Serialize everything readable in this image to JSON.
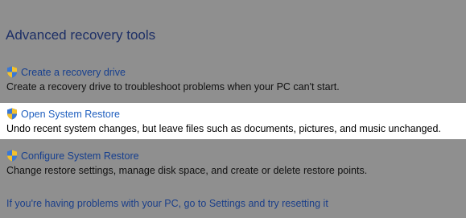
{
  "section": {
    "title": "Advanced recovery tools"
  },
  "tools": [
    {
      "label": "Create a recovery drive",
      "description": "Create a recovery drive to troubleshoot problems when your PC can't start.",
      "icon": "shield-icon"
    },
    {
      "label": "Open System Restore",
      "description": "Undo recent system changes, but leave files such as documents, pictures, and music unchanged.",
      "icon": "shield-icon",
      "highlighted": true
    },
    {
      "label": "Configure System Restore",
      "description": "Change restore settings, manage disk space, and create or delete restore points.",
      "icon": "shield-icon"
    }
  ],
  "footer": {
    "link": "If you're having problems with your PC, go to Settings and try resetting it"
  },
  "colors": {
    "background": "#8f8f8f",
    "highlight": "#ffffff",
    "link": "#163f8f",
    "title": "#1d2f66"
  }
}
